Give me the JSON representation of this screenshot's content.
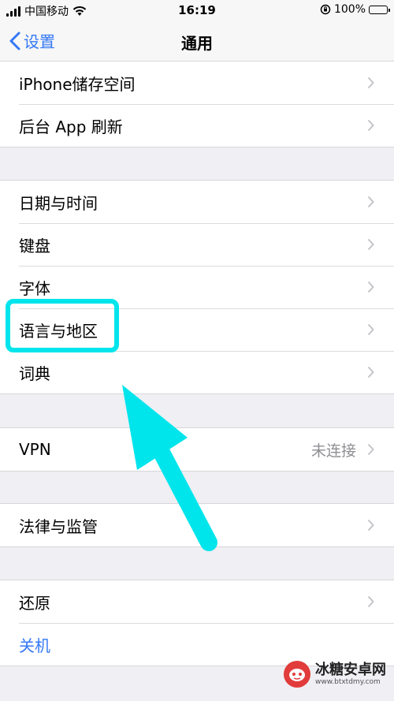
{
  "status_bar": {
    "carrier": "中国移动",
    "time": "16:19",
    "battery": "100%",
    "battery_level": 1.0
  },
  "nav": {
    "back_label": "设置",
    "title": "通用"
  },
  "groups": [
    {
      "rows": [
        {
          "label": "iPhone储存空间"
        },
        {
          "label": "后台 App 刷新"
        }
      ]
    },
    {
      "rows": [
        {
          "label": "日期与时间"
        },
        {
          "label": "键盘"
        },
        {
          "label": "字体"
        },
        {
          "label": "语言与地区"
        },
        {
          "label": "词典"
        }
      ]
    },
    {
      "rows": [
        {
          "label": "VPN",
          "value": "未连接"
        }
      ]
    },
    {
      "rows": [
        {
          "label": "法律与监管"
        }
      ]
    },
    {
      "rows": [
        {
          "label": "还原"
        },
        {
          "label": "关机"
        }
      ]
    }
  ],
  "annotation": {
    "highlight_color": "#00e5ec"
  },
  "watermark": {
    "title": "冰糖安卓网",
    "url": "www.btxtdmy.com"
  },
  "colors": {
    "accent": "#3478f6",
    "background": "#efeff4"
  }
}
